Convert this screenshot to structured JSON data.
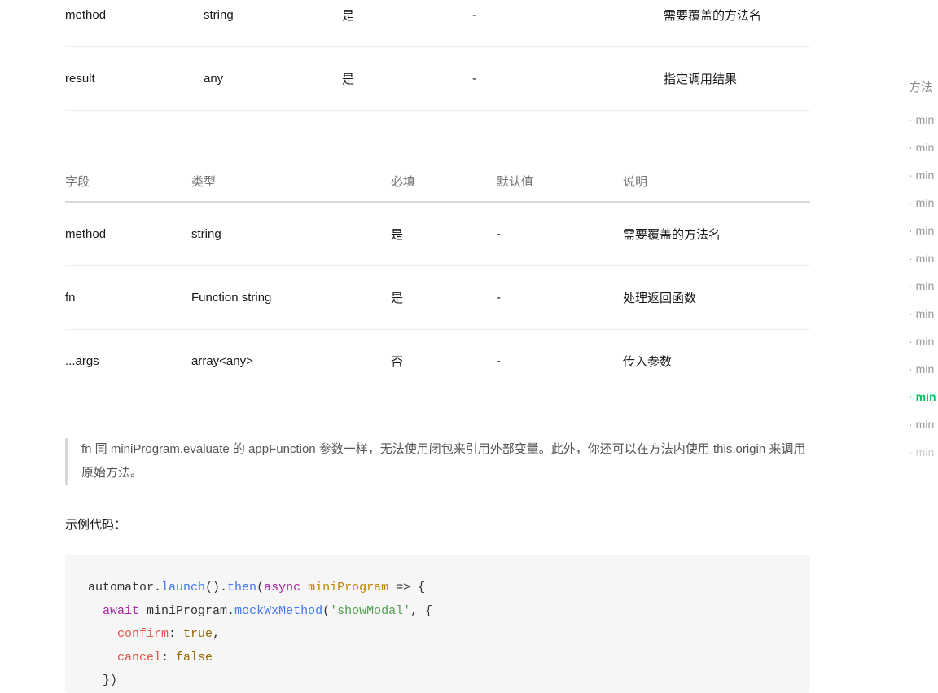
{
  "table1": {
    "rows": [
      {
        "field": "method",
        "type": "string",
        "required": "是",
        "default": "-",
        "desc": "需要覆盖的方法名"
      },
      {
        "field": "result",
        "type": "any",
        "required": "是",
        "default": "-",
        "desc": "指定调用结果"
      }
    ]
  },
  "table2": {
    "headers": {
      "field": "字段",
      "type": "类型",
      "required": "必填",
      "default": "默认值",
      "desc": "说明"
    },
    "rows": [
      {
        "field": "method",
        "type": "string",
        "required": "是",
        "default": "-",
        "desc": "需要覆盖的方法名"
      },
      {
        "field": "fn",
        "type": "Function string",
        "required": "是",
        "default": "-",
        "desc": "处理返回函数"
      },
      {
        "field": "...args",
        "type": "array<any>",
        "required": "否",
        "default": "-",
        "desc": "传入参数"
      }
    ]
  },
  "note_text": "fn 同 miniProgram.evaluate 的 appFunction 参数一样，无法使用闭包来引用外部变量。此外，你还可以在方法内使用 this.origin 来调用原始方法。",
  "example_label": "示例代码：",
  "code": {
    "l1a": "automator.",
    "l1b": "launch",
    "l1c": "().",
    "l1d": "then",
    "l1e": "(",
    "l1f": "async",
    "l1g": " ",
    "l1h": "miniProgram",
    "l1i": " => {",
    "l2a": "  ",
    "l2b": "await",
    "l2c": " miniProgram.",
    "l2d": "mockWxMethod",
    "l2e": "(",
    "l2f": "'showModal'",
    "l2g": ", {",
    "l3a": "    ",
    "l3b": "confirm",
    "l3c": ": ",
    "l3d": "true",
    "l3e": ",",
    "l4a": "    ",
    "l4b": "cancel",
    "l4c": ": ",
    "l4d": "false",
    "l5": "  })"
  },
  "toc": {
    "title": "方法",
    "items": [
      {
        "label": "min",
        "active": false
      },
      {
        "label": "min",
        "active": false
      },
      {
        "label": "min",
        "active": false
      },
      {
        "label": "min",
        "active": false
      },
      {
        "label": "min",
        "active": false
      },
      {
        "label": "min",
        "active": false
      },
      {
        "label": "min",
        "active": false
      },
      {
        "label": "min",
        "active": false
      },
      {
        "label": "min",
        "active": false
      },
      {
        "label": "min",
        "active": false
      },
      {
        "label": "min",
        "active": true
      },
      {
        "label": "min",
        "active": false
      },
      {
        "label": "min",
        "active": false,
        "faded": true
      }
    ]
  }
}
